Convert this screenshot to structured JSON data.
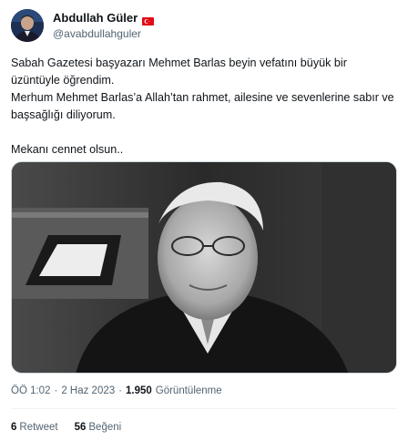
{
  "author": {
    "display_name": "Abdullah Güler",
    "handle": "@avabdullahguler",
    "flag_color": "#e30a17"
  },
  "tweet": {
    "lines": [
      "Sabah Gazetesi başyazarı Mehmet Barlas beyin vefatını büyük bir üzüntüyle öğrendim.",
      "Merhum Mehmet Barlas’a Allah’tan rahmet, ailesine ve sevenlerine sabır ve başsağlığı diliyorum.",
      "Mekanı cennet olsun.."
    ]
  },
  "media": {
    "type": "photo",
    "tone": "black-and-white"
  },
  "meta": {
    "time": "ÖÖ 1:02",
    "separator": "·",
    "date": "2 Haz 2023",
    "separator2": "·",
    "views_count": "1.950",
    "views_label": "Görüntülenme"
  },
  "stats": {
    "retweets_count": "6",
    "retweets_label": "Retweet",
    "likes_count": "56",
    "likes_label": "Beğeni"
  },
  "colors": {
    "text_primary": "#0f1419",
    "text_secondary": "#536471",
    "border": "#cfd9de"
  }
}
